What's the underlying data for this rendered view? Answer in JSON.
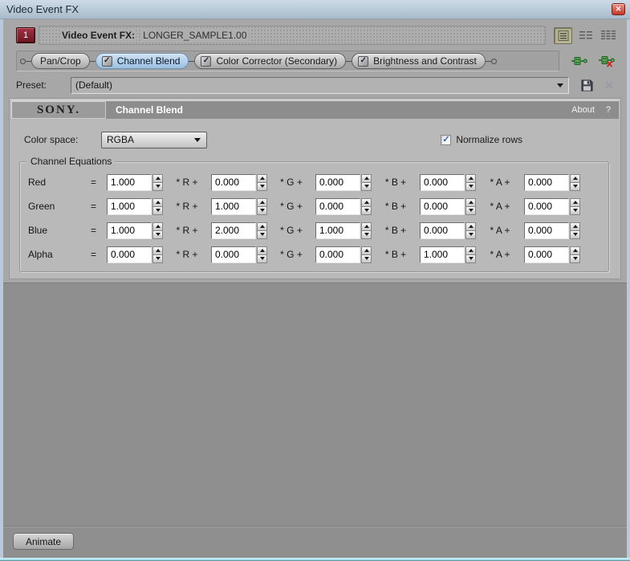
{
  "window": {
    "title": "Video Event FX"
  },
  "icons": {
    "close": "✕",
    "check": "✓"
  },
  "fx_header": {
    "badge": "1",
    "label": "Video Event FX:",
    "target_name": "LONGER_SAMPLE1.00"
  },
  "plugin_chain": {
    "tabs": [
      {
        "label": "Pan/Crop",
        "has_checkbox": false,
        "checked": false,
        "selected": false
      },
      {
        "label": "Channel Blend",
        "has_checkbox": true,
        "checked": true,
        "selected": true
      },
      {
        "label": "Color Corrector (Secondary)",
        "has_checkbox": true,
        "checked": true,
        "selected": false
      },
      {
        "label": "Brightness and Contrast",
        "has_checkbox": true,
        "checked": true,
        "selected": false
      }
    ]
  },
  "preset_row": {
    "label": "Preset:",
    "value": "(Default)"
  },
  "plugin_panel": {
    "brand": "SONY.",
    "title": "Channel Blend",
    "about_label": "About",
    "help_label": "?",
    "color_space": {
      "label": "Color space:",
      "value": "RGBA"
    },
    "normalize_rows": {
      "label": "Normalize rows",
      "checked": true
    },
    "equations": {
      "group_title": "Channel Equations",
      "equals_sign": "=",
      "operator_labels": [
        "* R +",
        "* G +",
        "* B +",
        "* A +"
      ],
      "rows": [
        {
          "label": "Red",
          "values": [
            "1.000",
            "0.000",
            "0.000",
            "0.000",
            "0.000"
          ]
        },
        {
          "label": "Green",
          "values": [
            "1.000",
            "1.000",
            "0.000",
            "0.000",
            "0.000"
          ]
        },
        {
          "label": "Blue",
          "values": [
            "1.000",
            "2.000",
            "1.000",
            "0.000",
            "0.000"
          ]
        },
        {
          "label": "Alpha",
          "values": [
            "0.000",
            "0.000",
            "0.000",
            "1.000",
            "0.000"
          ]
        }
      ]
    }
  },
  "footer": {
    "animate_label": "Animate"
  },
  "colors": {
    "titlebar": "#b9c9da",
    "selected_tab": "#aecbe9",
    "badge_red": "#8e2433",
    "sony_bar": "#8d8d8d",
    "panel_bg": "#b9b9b9",
    "content_bg": "#a7a7a7",
    "keyframe_area_bg": "#8f8f8f",
    "check_blue": "#2f5fc4",
    "bottom_edge": "#a9e2ef"
  }
}
